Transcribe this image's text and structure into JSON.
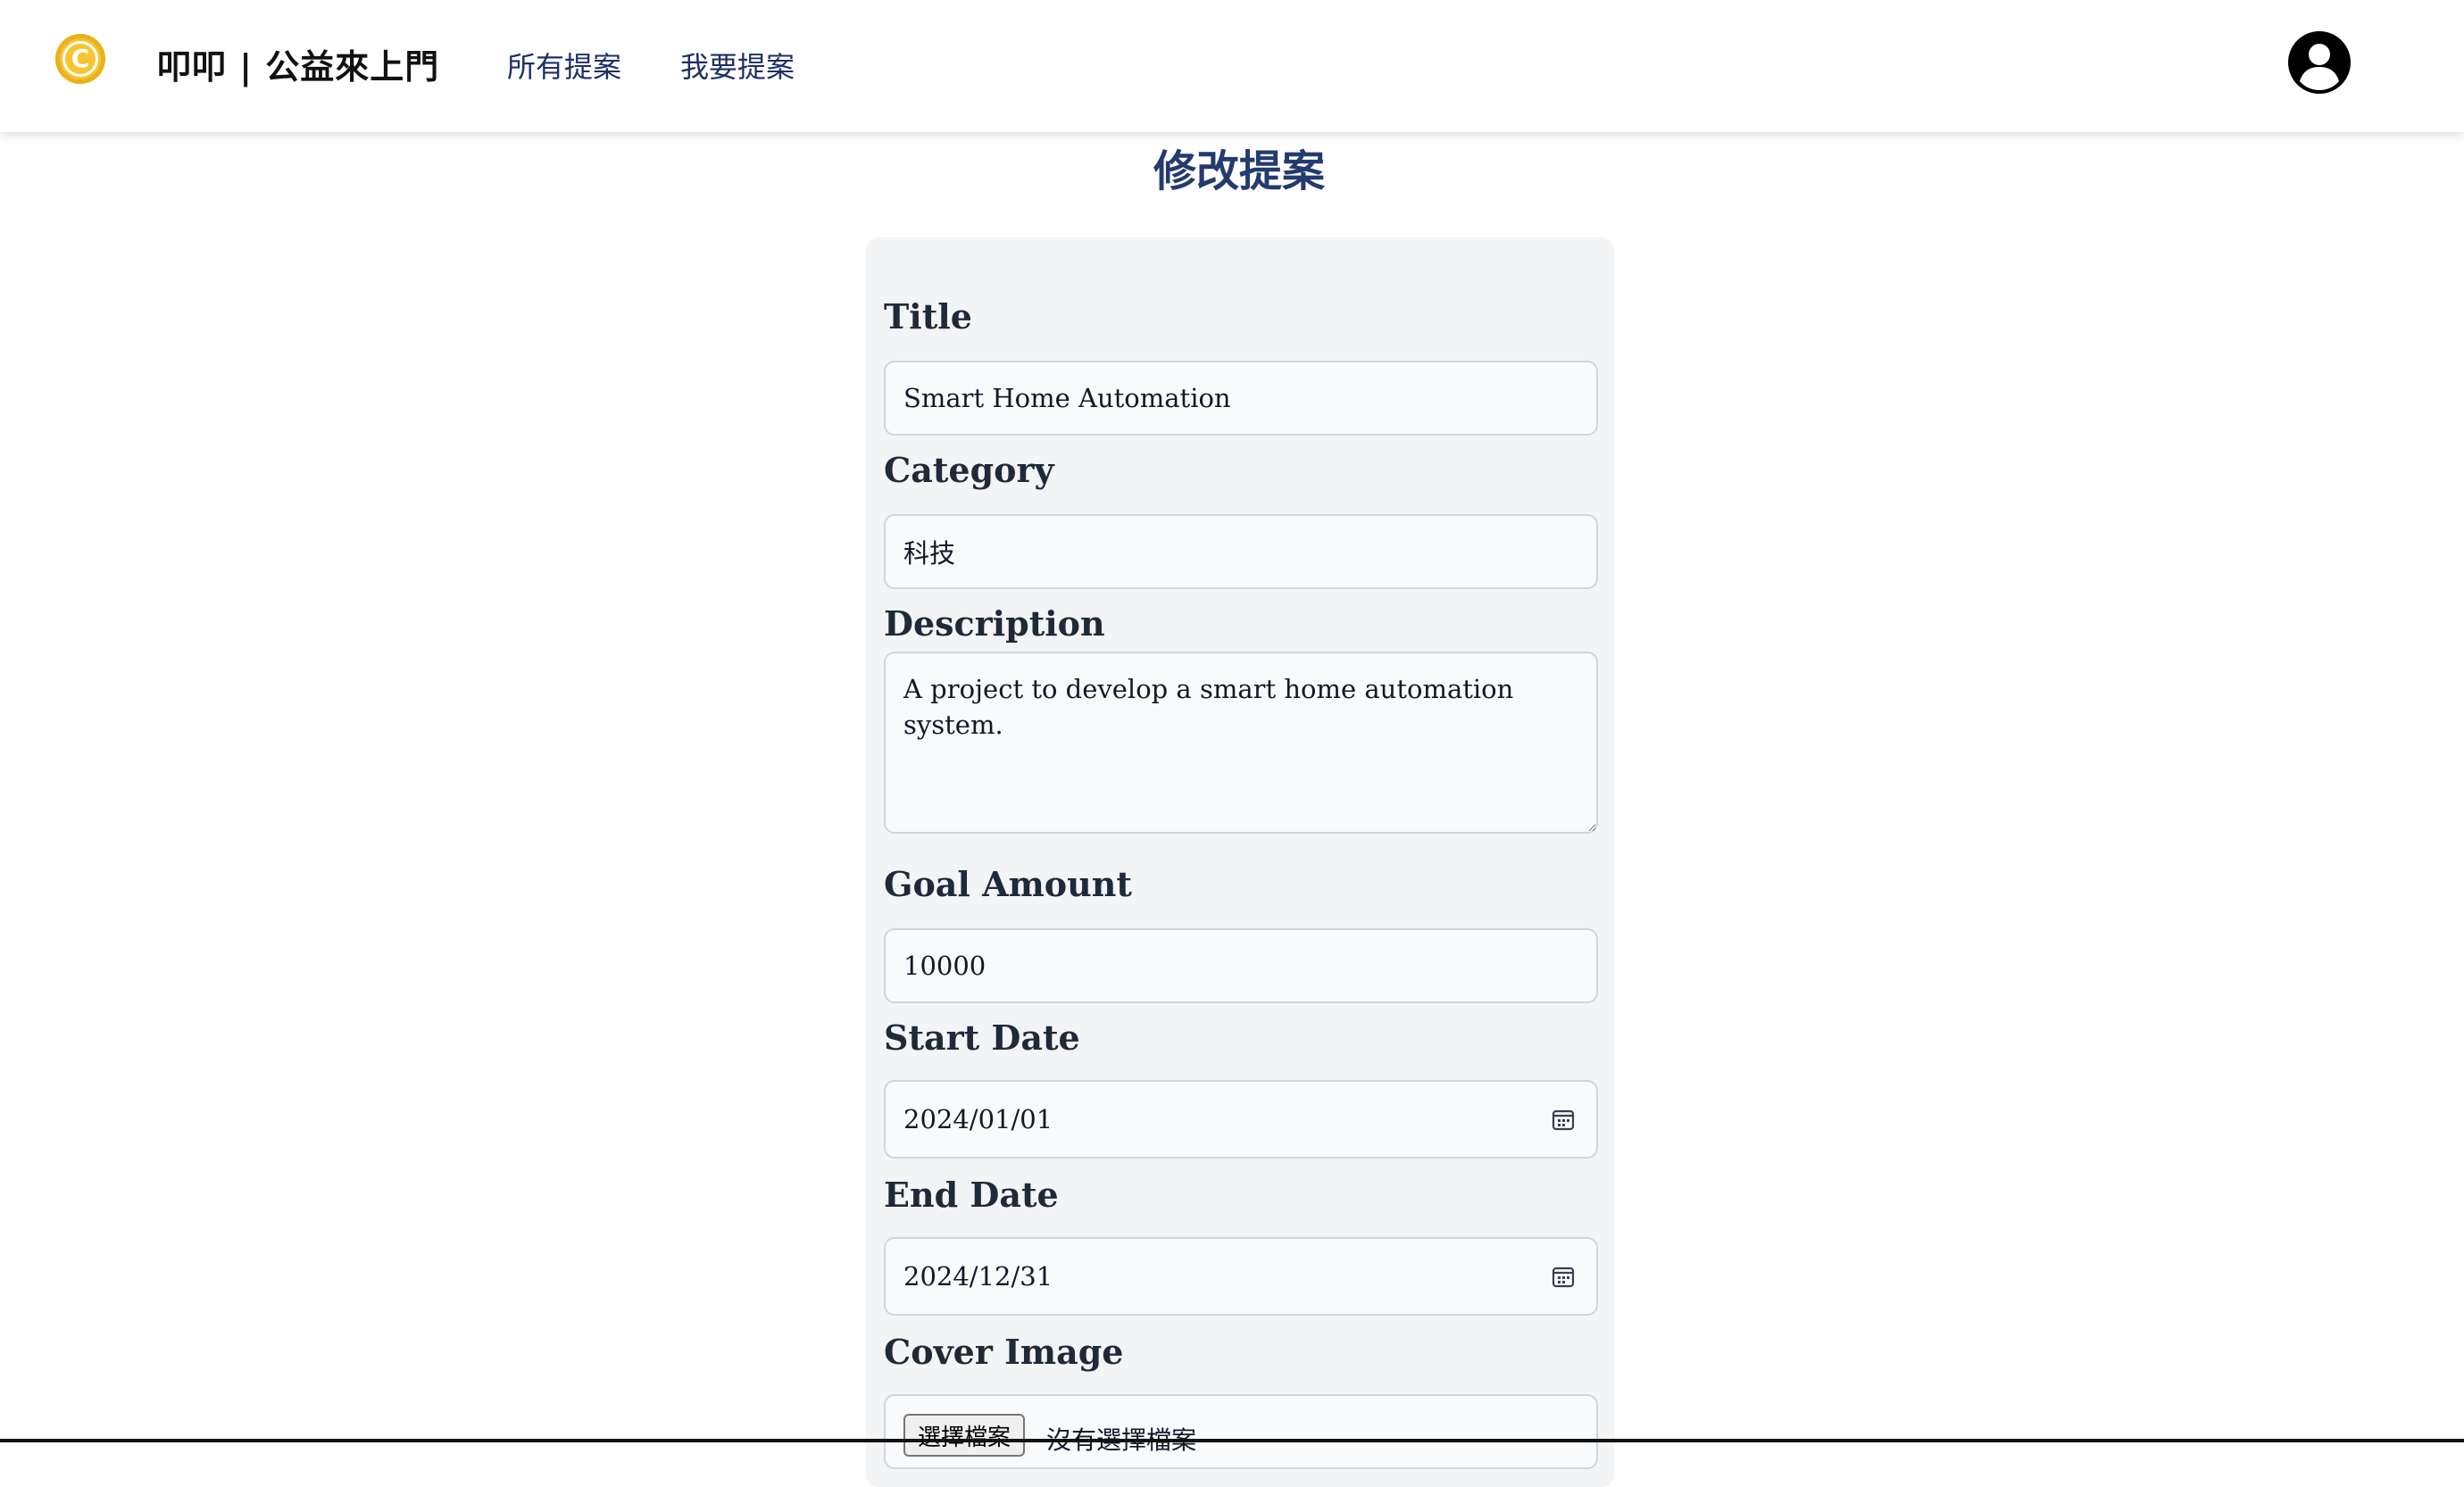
{
  "header": {
    "logo_glyph": "C",
    "brand": "叩叩 | 公益來上門",
    "nav": [
      {
        "label": "所有提案"
      },
      {
        "label": "我要提案"
      }
    ],
    "logo_color": "#f6c531",
    "nav_color": "#1e2f66"
  },
  "page": {
    "title": "修改提案",
    "title_color": "#233b6e"
  },
  "form": {
    "title_label": "Title",
    "title_value": "Smart Home Automation",
    "category_label": "Category",
    "category_value": "科技",
    "description_label": "Description",
    "description_value": "A project to develop a smart home automation system.",
    "goal_label": "Goal Amount",
    "goal_value": "10000",
    "start_label": "Start Date",
    "start_value": "2024/01/01",
    "end_label": "End Date",
    "end_value": "2024/12/31",
    "cover_label": "Cover Image",
    "file_button": "選擇檔案",
    "file_status": "沒有選擇檔案"
  },
  "icons": {
    "logo": "copyright-coin-icon",
    "avatar": "user-circle-icon",
    "date_picker": "calendar-icon"
  }
}
